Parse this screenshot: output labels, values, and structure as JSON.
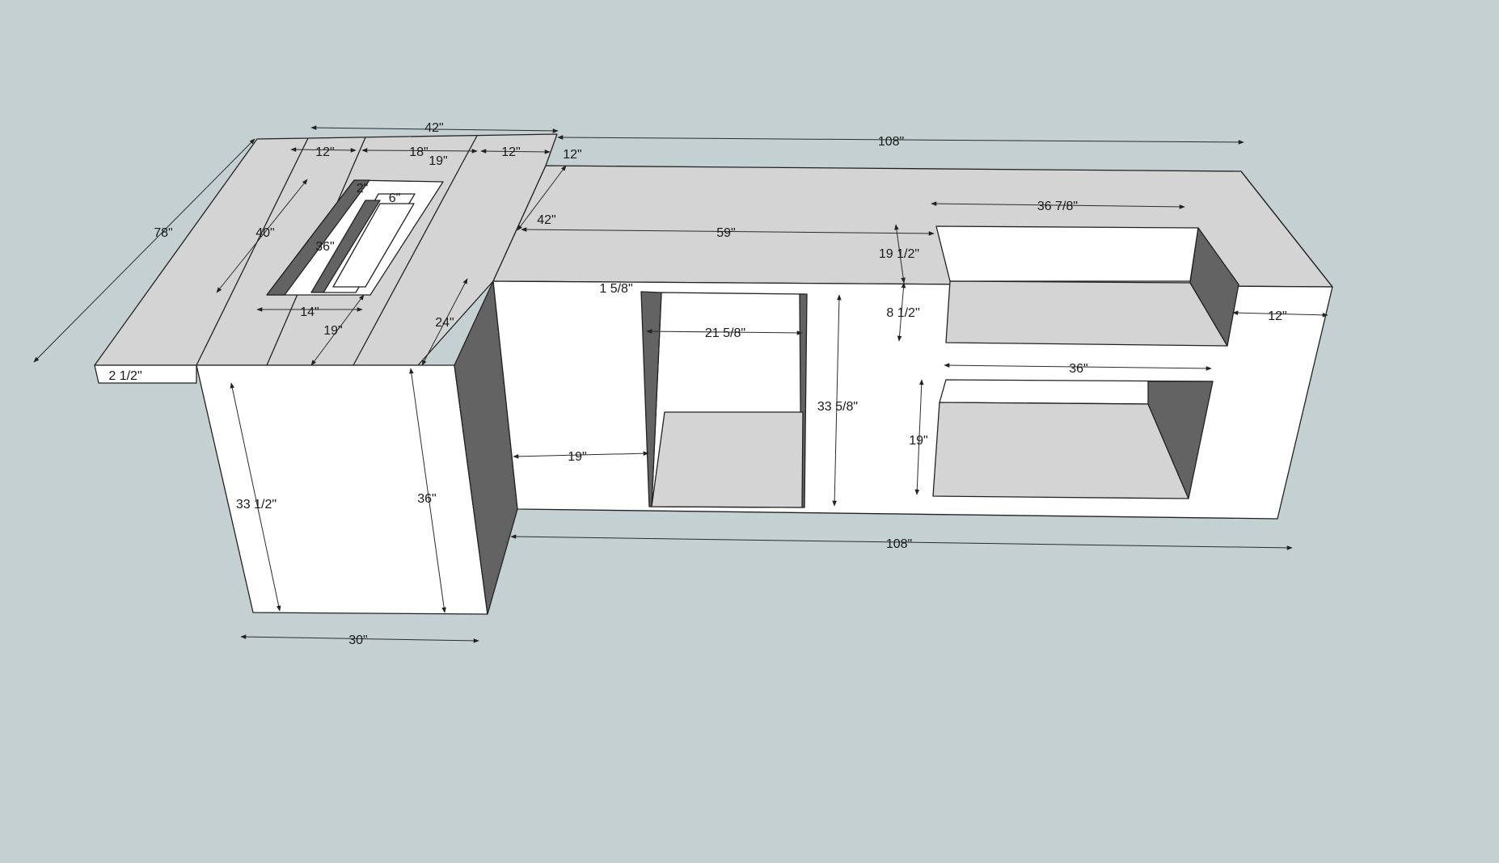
{
  "colors": {
    "background": "#c4d0d2",
    "top_surface": "#d4d4d4",
    "front_face": "#ffffff",
    "shadow_face": "#636363",
    "edge": "#222222"
  },
  "dimensions": {
    "top_width_left": "42\"",
    "seg_12_left": "12\"",
    "seg_18": "18\"",
    "seg_12_right": "12\"",
    "small_12": "12\"",
    "length_108_top": "108\"",
    "depth_78": "78\"",
    "cutout_19_top": "19\"",
    "cutout_2": "2\"",
    "cutout_6": "6\"",
    "cutout_40": "40\"",
    "cutout_36": "36\"",
    "cutout_14": "14\"",
    "cutout_19_bottom": "19\"",
    "depth_42_right": "42\"",
    "depth_24": "24\"",
    "thickness_2_5": "2 1/2\"",
    "height_33_5": "33 1/2\"",
    "height_36": "36\"",
    "width_30": "30\"",
    "span_59": "59\"",
    "gap_1_5_8": "1 5/8\"",
    "opening_21_5_8": "21 5/8\"",
    "height_33_5_8": "33 5/8\"",
    "offset_19": "19\"",
    "grill_36_7_8": "36 7/8\"",
    "grill_19_5": "19 1/2\"",
    "grill_8_5": "8 1/2\"",
    "end_12": "12\"",
    "lower_36": "36\"",
    "lower_19": "19\"",
    "length_108_bottom": "108\""
  }
}
